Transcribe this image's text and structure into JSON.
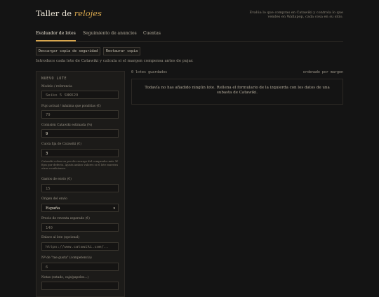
{
  "header": {
    "title_main": "Taller de ",
    "title_accent": "relojes",
    "tagline": "Evalúa lo que compras en Catawiki y controla lo que vendes en Wallapop, cada cosa en su sitio."
  },
  "tabs": [
    {
      "label": "Evaluador de lotes",
      "active": true
    },
    {
      "label": "Seguimiento de anuncios",
      "active": false
    },
    {
      "label": "Cuentas",
      "active": false
    }
  ],
  "toolbar": {
    "download_backup": "Descargar copia de seguridad",
    "restore_backup": "Restaurar copia"
  },
  "intro": "Introduce cada lote de Catawiki y calcula si el margen compensa antes de pujar.",
  "form": {
    "title": "NUEVO LOTE",
    "model_label": "Modelo / referencia",
    "model_placeholder": "Seiko 5 SNKK29",
    "price_label": "Pujo actual / máxima que pondrías (€)",
    "price_placeholder": "79",
    "commission_label": "Comisión Catawiki estimada (%)",
    "commission_value": "9",
    "fixed_fee_label": "Cuota fija de Catawiki (€)",
    "fixed_fee_value": "3",
    "fixed_fee_hint": "Catawiki cobra un pro de recargo del comprador más 3€ fijos por defecto. Ajusta ambos valores si el lote muestra otras condiciones.",
    "shipping_label": "Gastos de envío (€)",
    "shipping_placeholder": "15",
    "origin_label": "Origen del envío",
    "origin_value": "España",
    "sale_price_label": "Precio de reventa esperado (€)",
    "sale_price_placeholder": "140",
    "link_label": "Enlace al lote (opcional)",
    "link_placeholder": "https://www.catawiki.com/..",
    "likes_label": "Nº de \"me gusta\" (competencia)",
    "likes_placeholder": "6",
    "notes_label": "Notas (estado, caja/papeles...)"
  },
  "list": {
    "count": "0 lotes guardados",
    "sort": "ordenado por margen",
    "empty_message": "Todavía no has añadido ningún lote. Rellena el formulario de la izquierda con los datos de una subasta de Catawiki."
  },
  "colors": {
    "background": "#141414",
    "accent": "#d7a64d",
    "panel": "#1c1b19"
  }
}
